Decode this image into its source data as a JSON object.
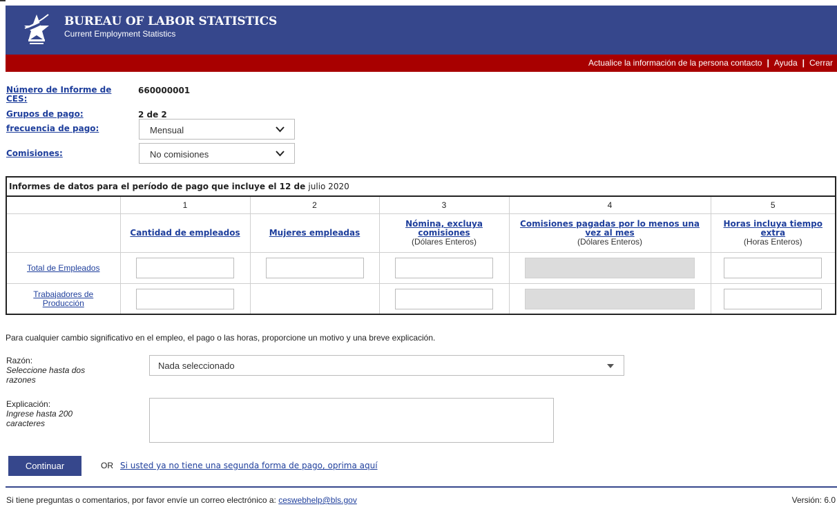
{
  "header": {
    "title": "BUREAU OF LABOR STATISTICS",
    "subtitle": "Current Employment Statistics",
    "nav": [
      "Actualice la información de la persona contacto",
      "Ayuda",
      "Cerrar"
    ],
    "nav_separator": "|"
  },
  "colors": {
    "navy": "#36478c",
    "red": "#a80000",
    "link": "#1f3f9c"
  },
  "icons": [
    "bls-logo-icon",
    "chevron-down-icon",
    "caret-down-icon"
  ],
  "report": {
    "report_number_label": "Número de Informe de CES:",
    "report_number": "660000001",
    "pay_groups_label": "Grupos de pago:",
    "pay_groups": "2 de 2",
    "pay_frequency_label": "frecuencia de pago:",
    "pay_frequency": "Mensual",
    "commissions_label": "Comisiones:",
    "commissions": "No comisiones"
  },
  "table": {
    "title": "Informes de datos para el período de pago que incluye el 12 de",
    "month": "julio 2020",
    "col_numbers": [
      "1",
      "2",
      "3",
      "4",
      "5"
    ],
    "columns": [
      {
        "label": "Cantidad de empleados",
        "sub": ""
      },
      {
        "label": "Mujeres empleadas",
        "sub": ""
      },
      {
        "label": "Nómina, excluya comisiones",
        "sub": "(Dólares Enteros)"
      },
      {
        "label": "Comisiones pagadas por lo menos una vez al mes",
        "sub": "(Dólares Enteros)"
      },
      {
        "label": "Horas incluya tiempo extra",
        "sub": "(Horas Enteros)"
      }
    ],
    "rows": [
      "Total de Empleados",
      "Trabajadores de Producción"
    ]
  },
  "explanation": {
    "note": "Para cualquier cambio significativo en el empleo, el pago o las horas, proporcione un motivo y una breve explicación.",
    "reason_label": "Razón:",
    "reason_hint": "Seleccione hasta dos razones",
    "reason_value": "Nada seleccionado",
    "explain_label": "Explicación:",
    "explain_hint": "Ingrese hasta 200 caracteres",
    "explain_value": ""
  },
  "actions": {
    "continue_label": "Continuar",
    "or_text": "OR",
    "secondary_link": "Si usted ya no tiene una segunda forma de pago, oprima aquí"
  },
  "footer": {
    "text": "Si tiene preguntas o comentarios, por favor envíe un correo electrónico a:",
    "email": "ceswebhelp@bls.gov",
    "version": "Versión: 6.0"
  }
}
